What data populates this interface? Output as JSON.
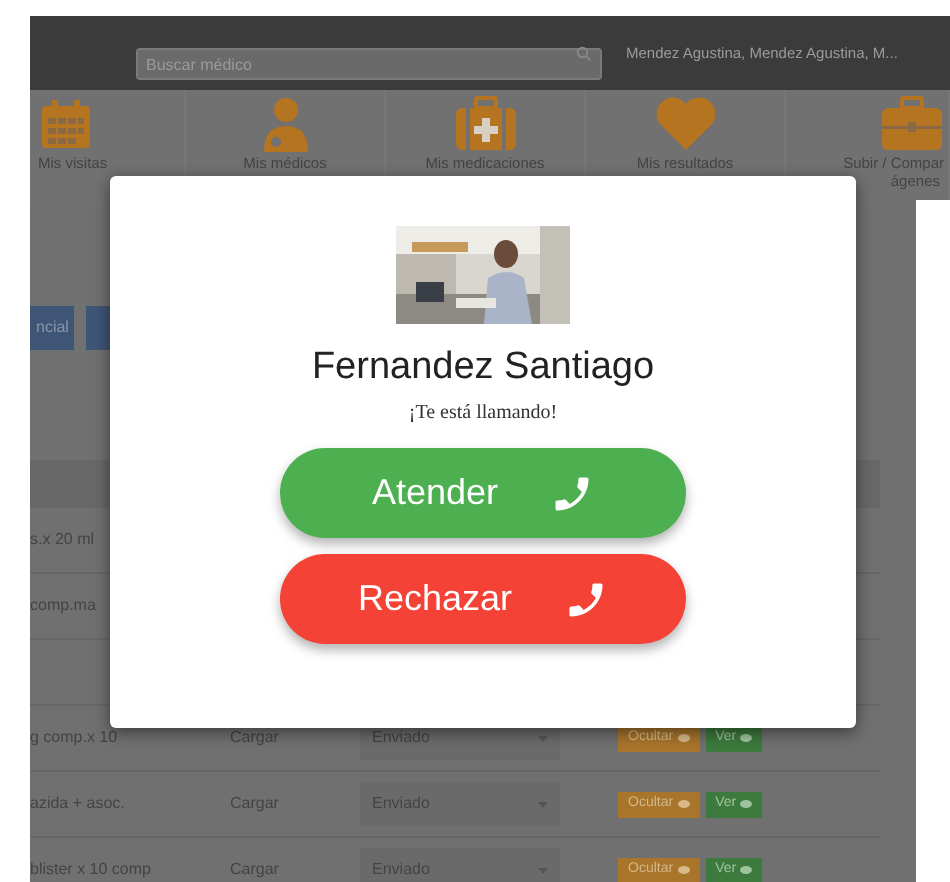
{
  "header": {
    "search": {
      "placeholder": "Buscar médico"
    },
    "user": "Mendez Agustina, Mendez Agustina, M..."
  },
  "nav": [
    {
      "label": "Mis visitas"
    },
    {
      "label": "Mis médicos"
    },
    {
      "label": "Mis medicaciones"
    },
    {
      "label": "Mis resultados"
    },
    {
      "label": "Subir / Compar",
      "label_2": "ágenes"
    }
  ],
  "toolbar": {
    "buttons": [
      "ncial"
    ]
  },
  "table": {
    "rows": [
      {
        "column_1": "s.x 20 ml"
      },
      {
        "column_1": "comp.ma"
      },
      {
        "column_1": ""
      },
      {
        "column_1": "g comp.x 10",
        "action": "Cargar",
        "status": "Enviado",
        "hide": "Ocultar",
        "view": "Ver"
      },
      {
        "column_1": "azida + asoc.",
        "action": "Cargar",
        "status": "Enviado",
        "hide": "Ocultar",
        "view": "Ver"
      },
      {
        "column_1": "blister x 10 comp",
        "action": "Cargar",
        "status": "Enviado",
        "hide": "Ocultar",
        "view": "Ver"
      }
    ]
  },
  "call_dialog": {
    "caller": "Fernandez Santiago",
    "message": "¡Te está llamando!",
    "buttons": [
      {
        "label": "Atender",
        "kind": "accept"
      },
      {
        "label": "Rechazar",
        "kind": "reject"
      }
    ]
  }
}
